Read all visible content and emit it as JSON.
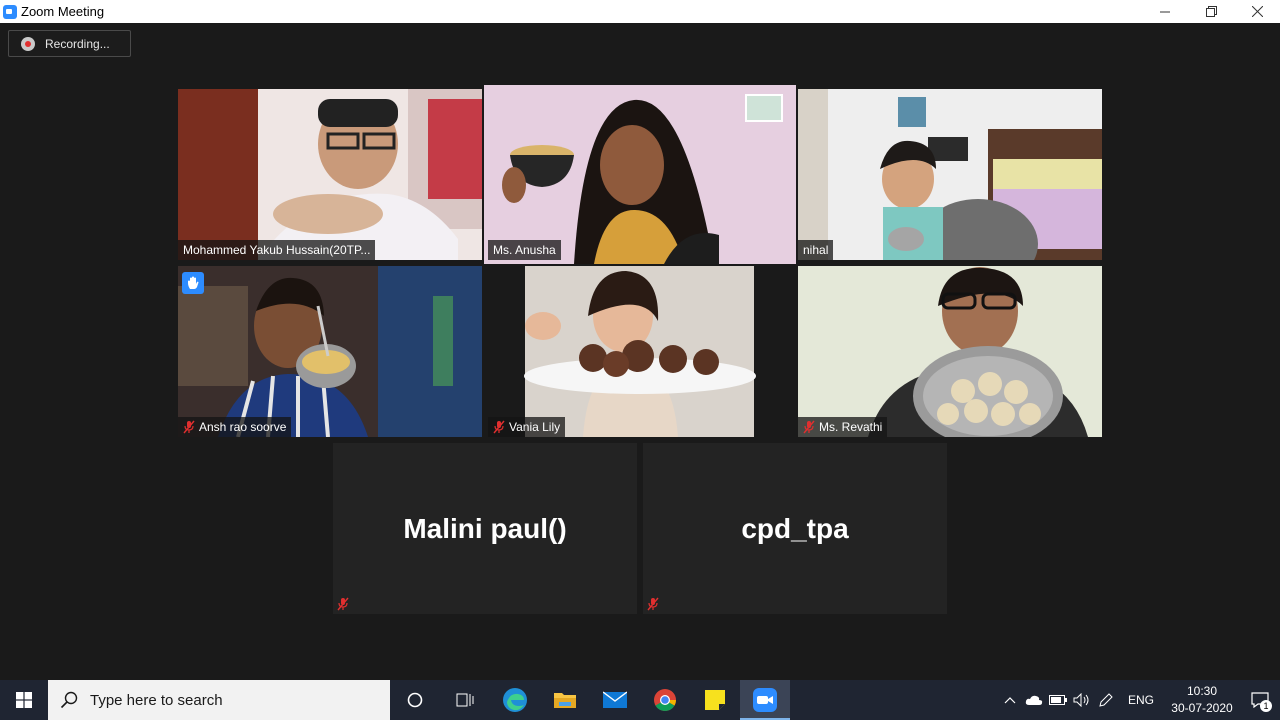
{
  "window": {
    "title": "Zoom Meeting",
    "controls": [
      "minimize",
      "restore",
      "close"
    ]
  },
  "recording": {
    "label": "Recording..."
  },
  "participants": [
    {
      "name": "Mohammed Yakub   Hussain(20TP...",
      "muted": false,
      "active": false,
      "hand_raised": false
    },
    {
      "name": "Ms. Anusha",
      "muted": false,
      "active": true,
      "hand_raised": false
    },
    {
      "name": "nihal",
      "muted": false,
      "active": false,
      "hand_raised": false
    },
    {
      "name": "Ansh rao soorve",
      "muted": true,
      "active": false,
      "hand_raised": true
    },
    {
      "name": "Vania Lily",
      "muted": true,
      "active": false,
      "hand_raised": false
    },
    {
      "name": "Ms. Revathi",
      "muted": true,
      "active": false,
      "hand_raised": false
    }
  ],
  "video_off": [
    {
      "name": "Malini paul()",
      "muted": true
    },
    {
      "name": "cpd_tpa",
      "muted": true
    }
  ],
  "taskbar": {
    "search_placeholder": "Type here to search",
    "apps": [
      "task-view",
      "edge",
      "file-explorer",
      "mail",
      "chrome",
      "sticky-notes",
      "zoom"
    ],
    "tray": {
      "language": "ENG",
      "time": "10:30",
      "date": "30-07-2020",
      "notifications": "1"
    }
  },
  "colors": {
    "background": "#1a1a1a",
    "active_speaker": "#d6e26b",
    "accent": "#2d8cff",
    "muted_icon": "#e02f2f"
  }
}
